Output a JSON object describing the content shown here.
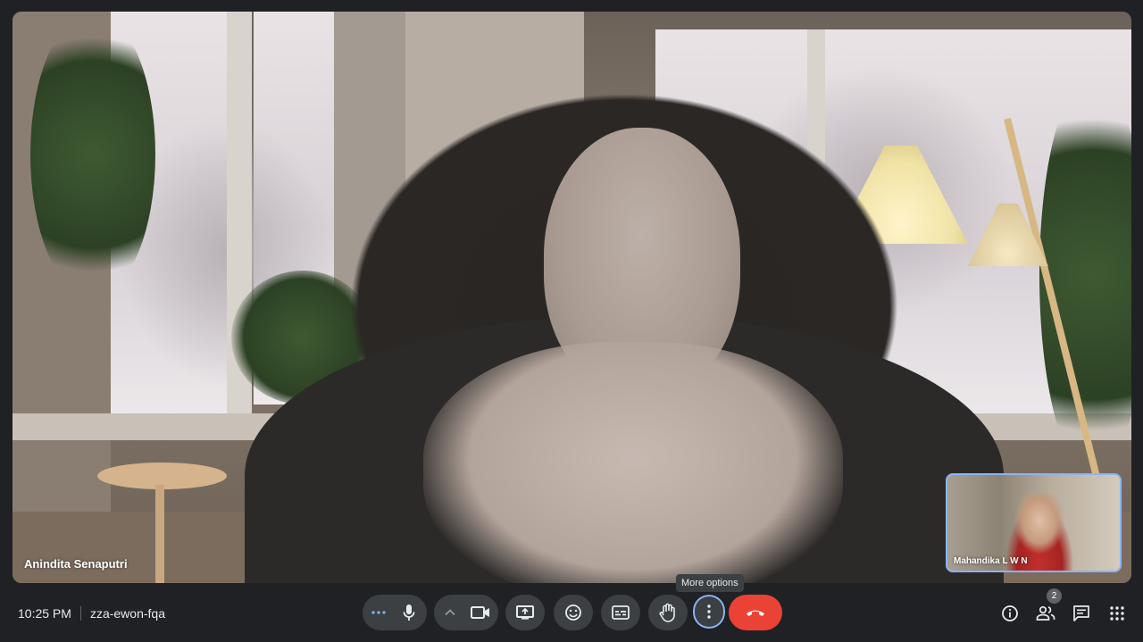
{
  "meeting": {
    "time": "10:25 PM",
    "code": "zza-ewon-fqa"
  },
  "main_participant": {
    "name": "Anindita Senaputri"
  },
  "self_view": {
    "name": "Mahandika L W N"
  },
  "controls": {
    "tooltip": "More options",
    "people_count": "2"
  },
  "colors": {
    "background": "#202124",
    "control_bg": "#3c4043",
    "hangup": "#ea4335",
    "focus_ring": "#8ab4f8"
  }
}
